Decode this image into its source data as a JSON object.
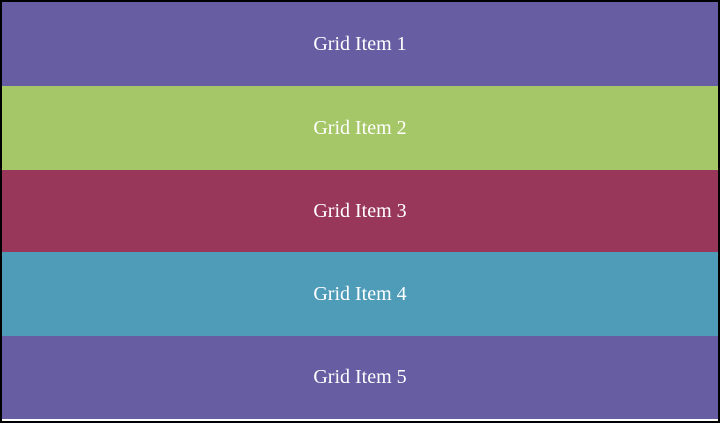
{
  "grid": {
    "items": [
      {
        "label": "Grid Item 1",
        "color": "#675da3"
      },
      {
        "label": "Grid Item 2",
        "color": "#a6c768"
      },
      {
        "label": "Grid Item 3",
        "color": "#99375a"
      },
      {
        "label": "Grid Item 4",
        "color": "#4f9cb9"
      },
      {
        "label": "Grid Item 5",
        "color": "#675da3"
      }
    ]
  }
}
